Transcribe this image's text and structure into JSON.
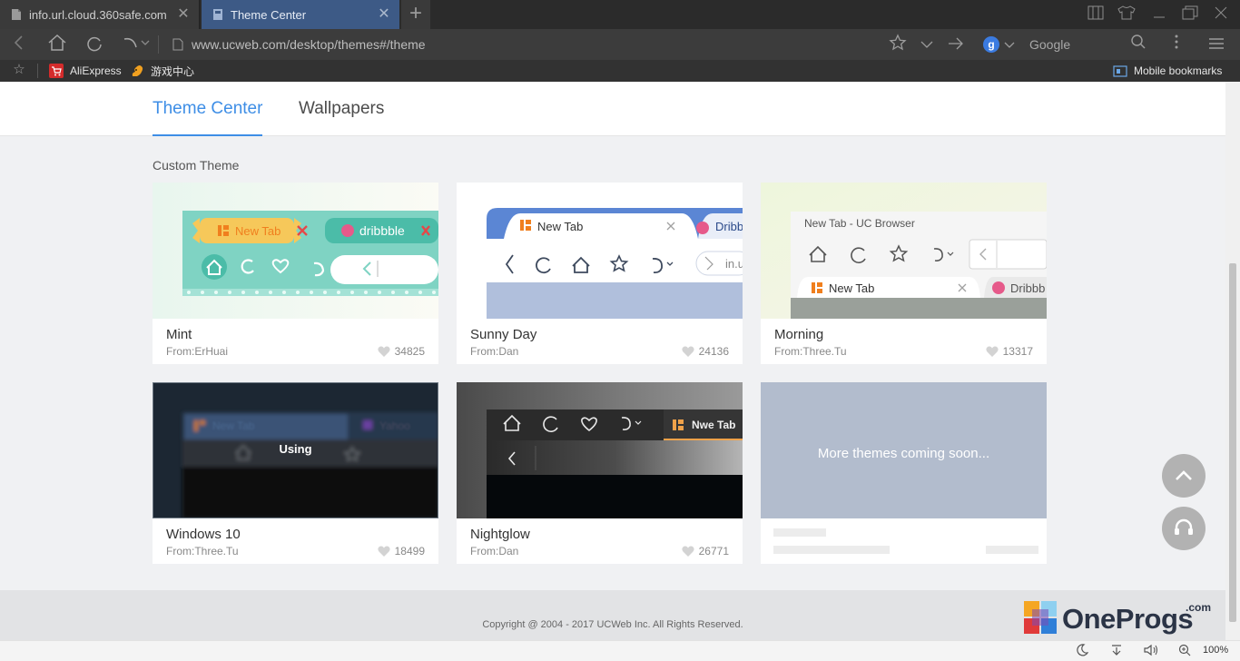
{
  "browser": {
    "tabs": [
      {
        "title": "info.url.cloud.360safe.com"
      },
      {
        "title": "Theme Center"
      }
    ],
    "url": "www.ucweb.com/desktop/themes#/theme",
    "search": {
      "engine_letter": "g",
      "engine_name": "Google"
    },
    "bookmarks": [
      {
        "label": "AliExpress"
      },
      {
        "label": "游戏中心"
      }
    ],
    "mobile_bookmarks": "Mobile bookmarks",
    "zoom": "100%"
  },
  "page": {
    "nav": {
      "tabs": [
        "Theme Center",
        "Wallpapers"
      ],
      "active_index": 0
    },
    "section_title": "Custom Theme",
    "themes": [
      {
        "name": "Mint",
        "author": "From:ErHuai",
        "likes": "34825",
        "preview": {
          "tab": "New Tab",
          "tab2": "dribbble"
        }
      },
      {
        "name": "Sunny Day",
        "author": "From:Dan",
        "likes": "24136",
        "preview": {
          "tab": "New Tab",
          "tab2": "Dribb",
          "url": "in.u"
        }
      },
      {
        "name": "Morning",
        "author": "From:Three.Tu",
        "likes": "13317",
        "preview": {
          "window": "New Tab - UC Browser",
          "tab": "New Tab",
          "tab2": "Dribbb"
        }
      },
      {
        "name": "Windows 10",
        "author": "From:Three.Tu",
        "likes": "18499",
        "badge": "Using",
        "preview": {
          "tab": "New Tab",
          "tab2": "Yahoo"
        }
      },
      {
        "name": "Nightglow",
        "author": "From:Dan",
        "likes": "26771",
        "preview": {
          "tab": "Nwe Tab"
        }
      }
    ],
    "more_themes": "More themes coming soon...",
    "copyright": "Copyright @ 2004 - 2017 UCWeb Inc. All Rights Reserved."
  },
  "brand": {
    "name": "OneProgs",
    "suffix": ".com"
  },
  "colors": {
    "accent": "#3e8ee6",
    "mint": "#7fd3c3",
    "placeholder_card": "#b2bccd"
  }
}
